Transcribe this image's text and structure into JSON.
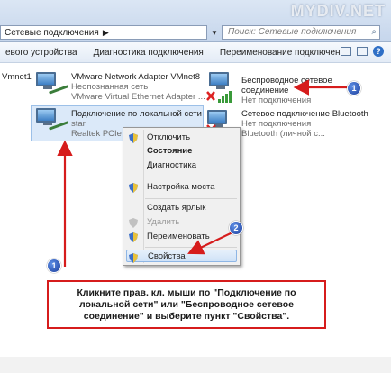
{
  "watermark": "MYDIV.NET",
  "address": {
    "text": "Сетевые подключения",
    "arrow": "▶"
  },
  "search": {
    "placeholder": "Поиск: Сетевые подключения"
  },
  "toolbar": {
    "items": [
      "евого устройства",
      "Диагностика подключения",
      "Переименование подключения"
    ]
  },
  "items": [
    {
      "name": "Vmnet1",
      "status": "",
      "adapter": ""
    },
    {
      "name": "VMware Network Adapter VMnet8",
      "status": "Неопознанная сеть",
      "adapter": "VMware Virtual Ethernet Adapter ..."
    },
    {
      "name": "Беспроводное сетевое соединение",
      "status": "Нет подключения",
      "adapter": ""
    },
    {
      "name": "Подключение по локальной сети",
      "status": "star",
      "adapter": "Realtek PCIe GB"
    },
    {
      "name": "Сетевое подключение Bluetooth",
      "status": "Нет подключения",
      "adapter": "Bluetooth (личной с..."
    }
  ],
  "menu": {
    "items": [
      {
        "label": "Отключить",
        "shield": true
      },
      {
        "label": "Состояние",
        "bold": true
      },
      {
        "label": "Диагностика"
      },
      {
        "label": "Настройка моста",
        "shield": true
      },
      {
        "label": "Создать ярлык"
      },
      {
        "label": "Удалить",
        "shield": true,
        "disabled": true
      },
      {
        "label": "Переименовать",
        "shield": true
      },
      {
        "label": "Свойства",
        "shield": true
      }
    ]
  },
  "badges": [
    "1",
    "2",
    "1"
  ],
  "note": "Кликните прав. кл. мыши по \"Подключение по локальной сети\" или \"Беспроводное сетевое соединение\" и выберите пункт \"Свойства\".",
  "colors": {
    "callout_red": "#d61c1c",
    "badge_blue": "#1d3e9b",
    "selection": "#dbe9f9"
  }
}
